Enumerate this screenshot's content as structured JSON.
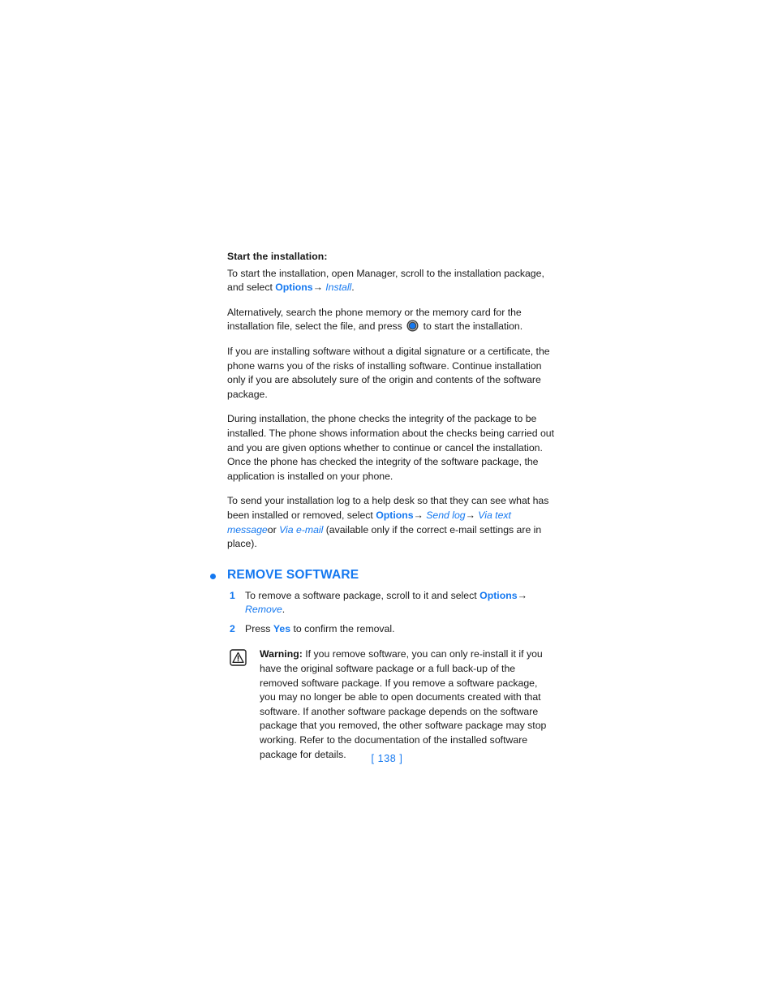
{
  "document": {
    "page_number_label": "[ 138 ]"
  },
  "subheading": {
    "start_installation": "Start the installation:"
  },
  "paragraphs": {
    "p1_a": "To start the installation, open Manager, scroll to the installation package, and select ",
    "p1_options": "Options",
    "p1_arrow": "→",
    "p1_install": "Install",
    "p1_end": ".",
    "p2_a": "Alternatively, search the phone memory or the memory card for the installation file, select the file, and press ",
    "p2_b": " to start the installation.",
    "p3": "If you are installing software without a digital signature or a certificate, the phone warns you of the risks of installing software. Continue installation only if you are absolutely sure of the origin and contents of the software package.",
    "p4": "During installation, the phone checks the integrity of the package to be installed. The phone shows information about the checks being carried out and you are given options whether to continue or cancel the installation. Once the phone has checked the integrity of the software package, the application is installed on your phone.",
    "p5_a": "To send your installation log to a help desk so that they can see what has been installed or removed, select ",
    "p5_options": "Options",
    "p5_arrow1": "→",
    "p5_sendlog": "Send log",
    "p5_arrow2": "→",
    "p5_viatext": "Via text message",
    "p5_or": "or ",
    "p5_viaemail": "Via e-mail",
    "p5_end": " (available only if the correct e-mail settings are in place)."
  },
  "section": {
    "title": "REMOVE SOFTWARE",
    "steps": [
      {
        "number": "1",
        "text_a": "To remove a software package, scroll to it and select ",
        "options": "Options",
        "arrow": "→",
        "action": "Remove",
        "text_b": "."
      },
      {
        "number": "2",
        "text_a": "Press ",
        "highlight": "Yes",
        "text_b": " to confirm the removal."
      }
    ]
  },
  "warning": {
    "label": "Warning:",
    "text": " If you remove software, you can only re-install it if you have the original software package or a full back-up of the removed software package. If you remove a software package, you may no longer be able to open documents created with that software. If another software package depends on the software package that you removed, the other software package may stop working. Refer to the documentation of the installed software package for details."
  },
  "colors": {
    "accent_blue": "#1478f0",
    "body_text": "#1a1a1a"
  }
}
